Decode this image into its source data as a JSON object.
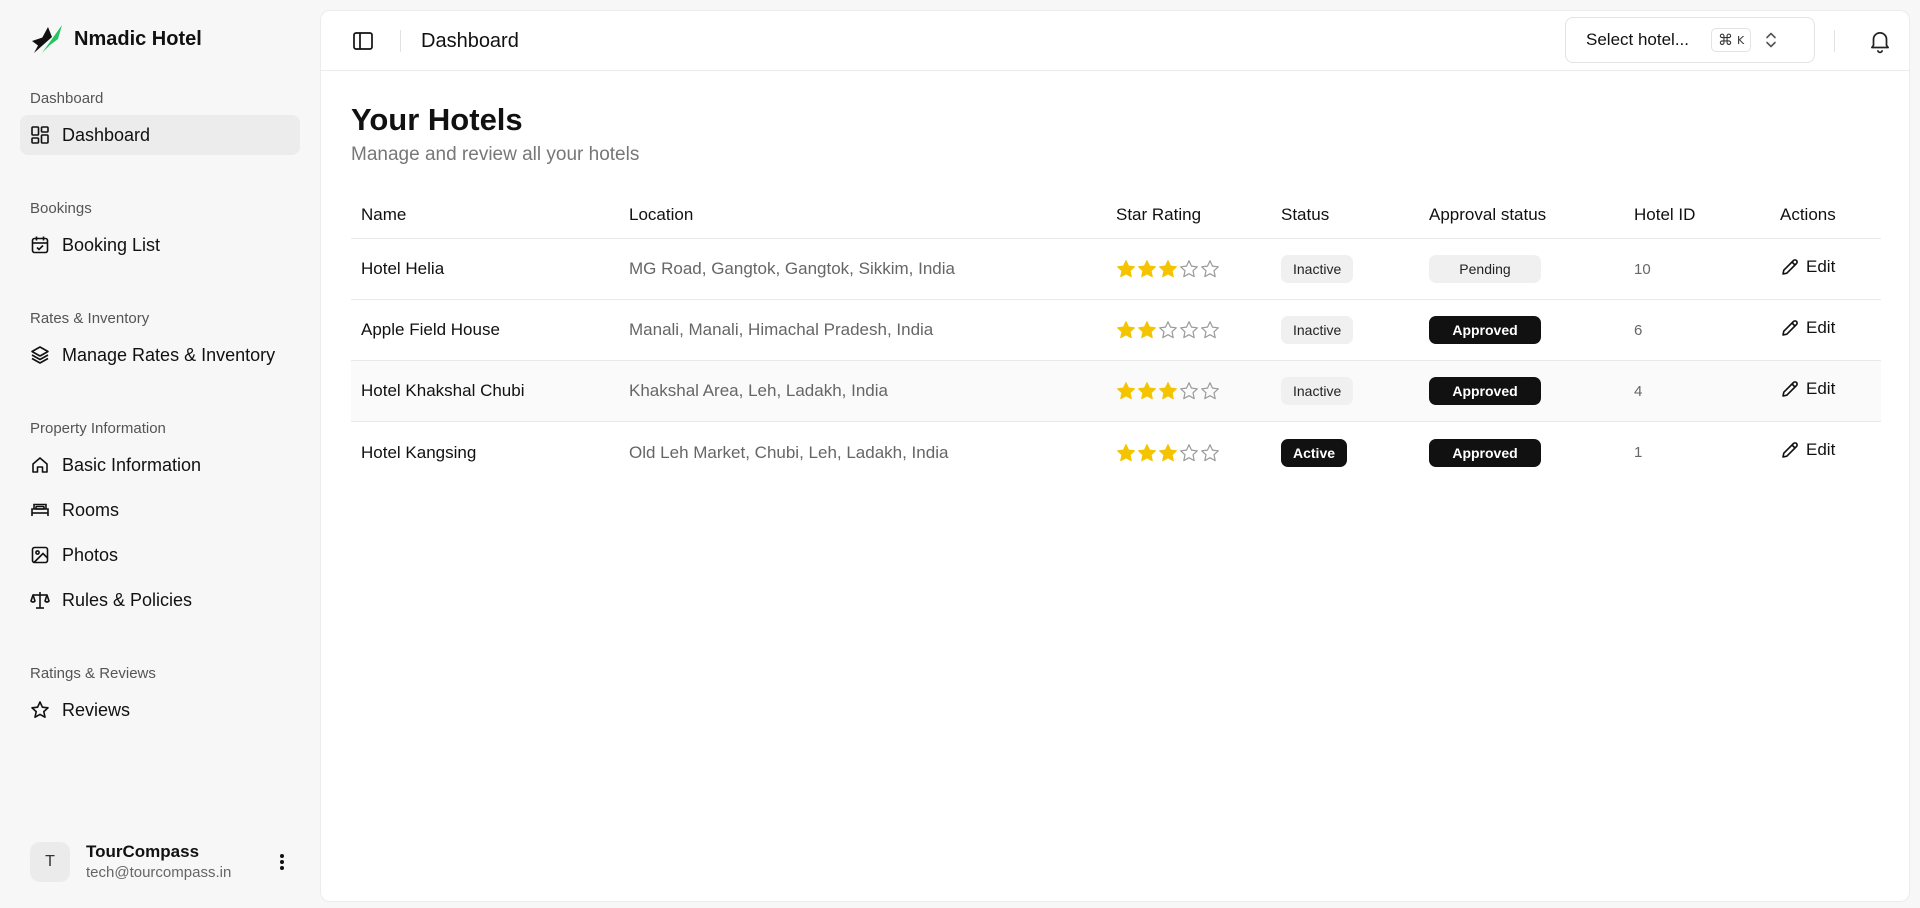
{
  "brand": {
    "name": "Nmadic Hotel",
    "logo_icon": "leaf-logo-icon",
    "accent": "#16a34a"
  },
  "sidebar": {
    "groups": [
      {
        "label": "Dashboard",
        "items": [
          {
            "label": "Dashboard",
            "icon": "dashboard-icon",
            "active": true
          }
        ]
      },
      {
        "label": "Bookings",
        "items": [
          {
            "label": "Booking List",
            "icon": "calendar-check-icon"
          }
        ]
      },
      {
        "label": "Rates & Inventory",
        "items": [
          {
            "label": "Manage Rates & Inventory",
            "icon": "layers-icon"
          }
        ]
      },
      {
        "label": "Property Information",
        "items": [
          {
            "label": "Basic Information",
            "icon": "home-icon"
          },
          {
            "label": "Rooms",
            "icon": "bed-icon"
          },
          {
            "label": "Photos",
            "icon": "image-icon"
          },
          {
            "label": "Rules & Policies",
            "icon": "scale-icon"
          }
        ]
      },
      {
        "label": "Ratings & Reviews",
        "items": [
          {
            "label": "Reviews",
            "icon": "star-icon"
          }
        ]
      }
    ],
    "user": {
      "initial": "T",
      "name": "TourCompass",
      "email": "tech@tourcompass.in"
    }
  },
  "topbar": {
    "title": "Dashboard",
    "hotel_select": {
      "label": "Select hotel...",
      "shortcut_mod": "⌘",
      "shortcut_key": "K"
    }
  },
  "main": {
    "title": "Your Hotels",
    "subtitle": "Manage and review all your hotels",
    "table": {
      "columns": [
        "Name",
        "Location",
        "Star Rating",
        "Status",
        "Approval status",
        "Hotel ID",
        "Actions"
      ],
      "rows": [
        {
          "name": "Hotel Helia",
          "location": "MG Road, Gangtok, Gangtok, Sikkim, India",
          "stars": 3,
          "status": "Inactive",
          "approval": "Pending",
          "hotel_id": "10",
          "action": "Edit"
        },
        {
          "name": "Apple Field House",
          "location": "Manali, Manali, Himachal Pradesh, India",
          "stars": 2,
          "status": "Inactive",
          "approval": "Approved",
          "hotel_id": "6",
          "action": "Edit"
        },
        {
          "name": "Hotel Khakshal Chubi",
          "location": "Khakshal Area, Leh, Ladakh, India",
          "stars": 3,
          "status": "Inactive",
          "approval": "Approved",
          "hotel_id": "4",
          "action": "Edit"
        },
        {
          "name": "Hotel Kangsing",
          "location": "Old Leh Market, Chubi, Leh, Ladakh, India",
          "stars": 3,
          "status": "Active",
          "approval": "Approved",
          "hotel_id": "1",
          "action": "Edit"
        }
      ],
      "max_stars": 5,
      "star_color": "#f5c400"
    }
  }
}
